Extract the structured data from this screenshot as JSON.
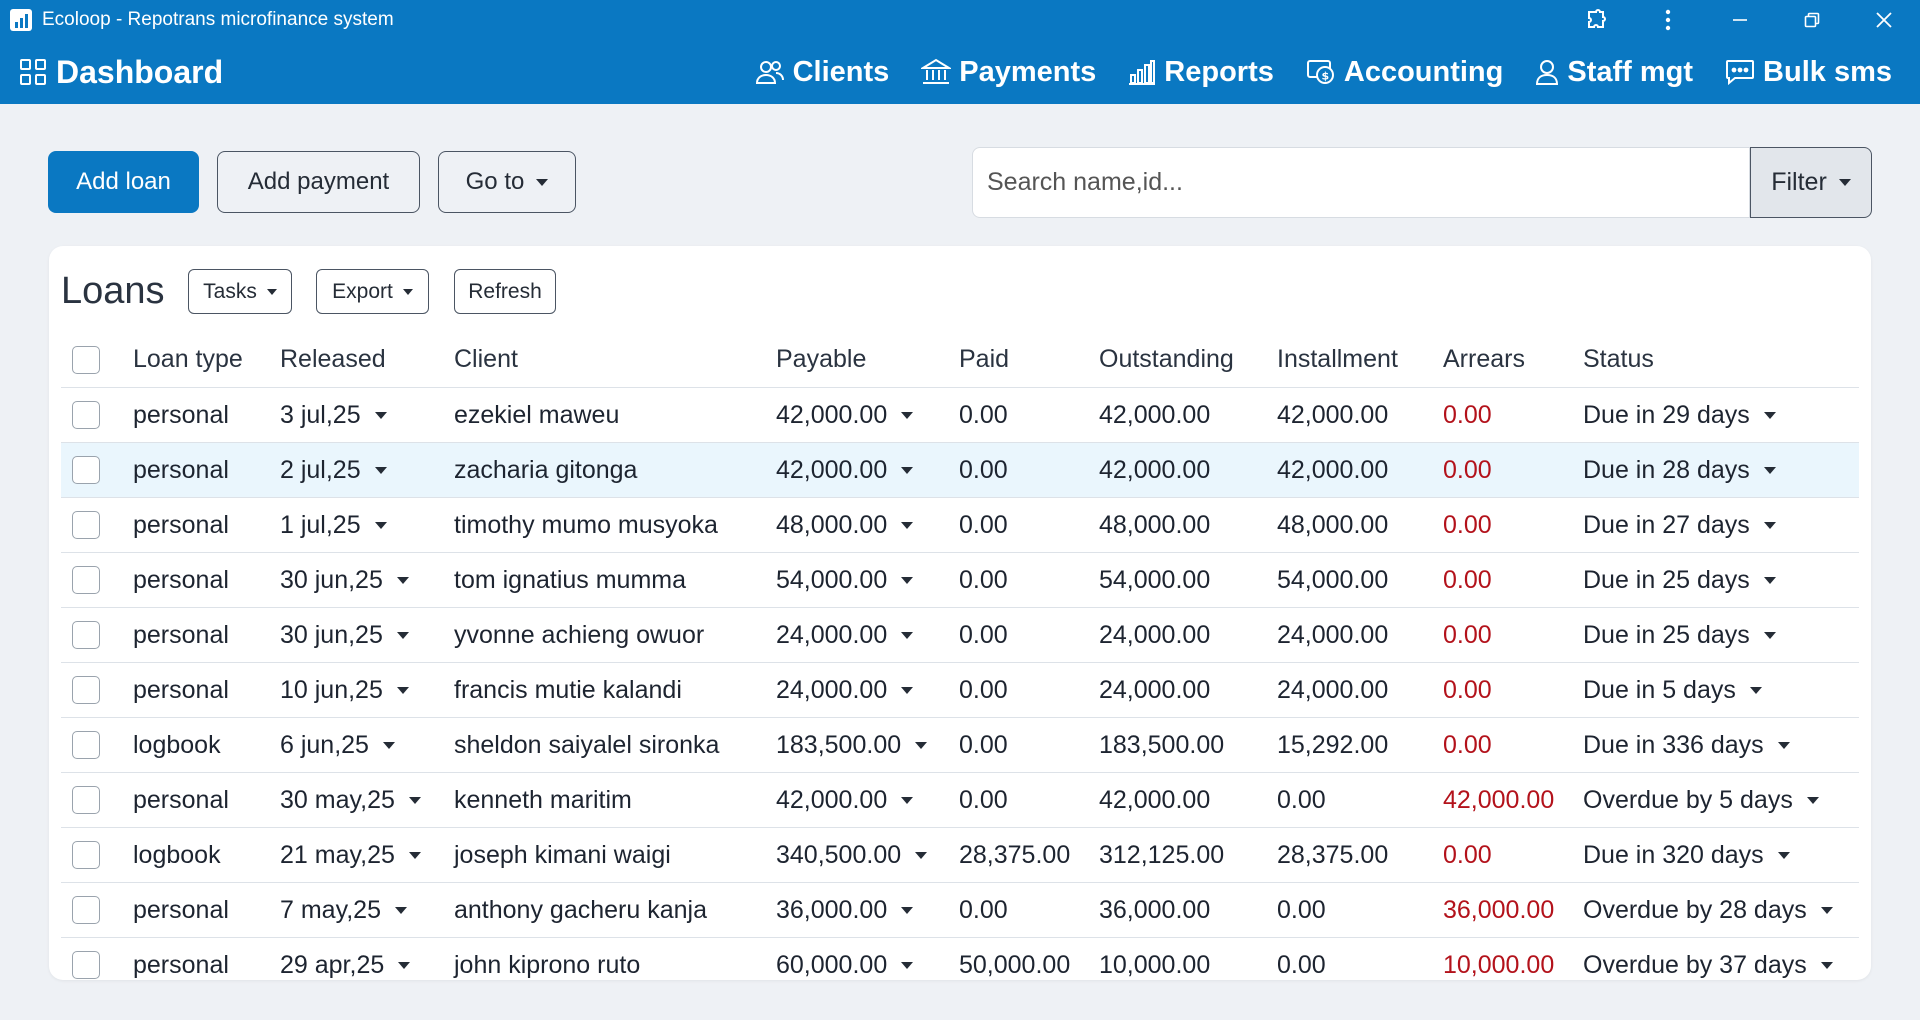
{
  "window": {
    "title": "Ecoloop - Repotrans microfinance system",
    "controls": [
      "extension-icon",
      "more-icon",
      "minimize-icon",
      "restore-icon",
      "close-icon"
    ]
  },
  "nav": {
    "brand": "Dashboard",
    "links": [
      {
        "label": "Clients",
        "icon": "clients-icon"
      },
      {
        "label": "Payments",
        "icon": "bank-icon"
      },
      {
        "label": "Reports",
        "icon": "bar-chart-icon"
      },
      {
        "label": "Accounting",
        "icon": "accounting-icon"
      },
      {
        "label": "Staff mgt",
        "icon": "person-icon"
      },
      {
        "label": "Bulk sms",
        "icon": "chat-icon"
      }
    ]
  },
  "toolbar": {
    "add_loan": "Add loan",
    "add_payment": "Add payment",
    "go_to": "Go to",
    "search_placeholder": "Search name,id...",
    "filter": "Filter"
  },
  "loans": {
    "title": "Loans",
    "tasks": "Tasks",
    "export": "Export",
    "refresh": "Refresh",
    "columns": {
      "loan_type": "Loan type",
      "released": "Released",
      "client": "Client",
      "payable": "Payable",
      "paid": "Paid",
      "outstanding": "Outstanding",
      "installment": "Installment",
      "arrears": "Arrears",
      "status": "Status"
    },
    "rows": [
      {
        "type": "personal",
        "released": "3 jul,25",
        "client": "ezekiel maweu",
        "payable": "42,000.00",
        "paid": "0.00",
        "outstanding": "42,000.00",
        "installment": "42,000.00",
        "arrears": "0.00",
        "status": "Due in 29 days"
      },
      {
        "type": "personal",
        "released": "2 jul,25",
        "client": "zacharia gitonga",
        "payable": "42,000.00",
        "paid": "0.00",
        "outstanding": "42,000.00",
        "installment": "42,000.00",
        "arrears": "0.00",
        "status": "Due in 28 days"
      },
      {
        "type": "personal",
        "released": "1 jul,25",
        "client": "timothy mumo musyoka",
        "payable": "48,000.00",
        "paid": "0.00",
        "outstanding": "48,000.00",
        "installment": "48,000.00",
        "arrears": "0.00",
        "status": "Due in 27 days"
      },
      {
        "type": "personal",
        "released": "30 jun,25",
        "client": "tom ignatius mumma",
        "payable": "54,000.00",
        "paid": "0.00",
        "outstanding": "54,000.00",
        "installment": "54,000.00",
        "arrears": "0.00",
        "status": "Due in 25 days"
      },
      {
        "type": "personal",
        "released": "30 jun,25",
        "client": "yvonne achieng owuor",
        "payable": "24,000.00",
        "paid": "0.00",
        "outstanding": "24,000.00",
        "installment": "24,000.00",
        "arrears": "0.00",
        "status": "Due in 25 days"
      },
      {
        "type": "personal",
        "released": "10 jun,25",
        "client": "francis mutie kalandi",
        "payable": "24,000.00",
        "paid": "0.00",
        "outstanding": "24,000.00",
        "installment": "24,000.00",
        "arrears": "0.00",
        "status": "Due in 5 days"
      },
      {
        "type": "logbook",
        "released": "6 jun,25",
        "client": "sheldon saiyalel sironka",
        "payable": "183,500.00",
        "paid": "0.00",
        "outstanding": "183,500.00",
        "installment": "15,292.00",
        "arrears": "0.00",
        "status": "Due in 336 days"
      },
      {
        "type": "personal",
        "released": "30 may,25",
        "client": "kenneth maritim",
        "payable": "42,000.00",
        "paid": "0.00",
        "outstanding": "42,000.00",
        "installment": "0.00",
        "arrears": "42,000.00",
        "status": "Overdue by 5 days"
      },
      {
        "type": "logbook",
        "released": "21 may,25",
        "client": "joseph kimani waigi",
        "payable": "340,500.00",
        "paid": "28,375.00",
        "outstanding": "312,125.00",
        "installment": "28,375.00",
        "arrears": "0.00",
        "status": "Due in 320 days"
      },
      {
        "type": "personal",
        "released": "7 may,25",
        "client": "anthony gacheru kanja",
        "payable": "36,000.00",
        "paid": "0.00",
        "outstanding": "36,000.00",
        "installment": "0.00",
        "arrears": "36,000.00",
        "status": "Overdue by 28 days"
      },
      {
        "type": "personal",
        "released": "29 apr,25",
        "client": "john kiprono ruto",
        "payable": "60,000.00",
        "paid": "50,000.00",
        "outstanding": "10,000.00",
        "installment": "0.00",
        "arrears": "10,000.00",
        "status": "Overdue by 37 days"
      }
    ]
  },
  "colors": {
    "primary": "#0a78c2",
    "arrears_red": "#b3121b",
    "row_highlight": "#eaf6fd",
    "background": "#eef1f5"
  }
}
